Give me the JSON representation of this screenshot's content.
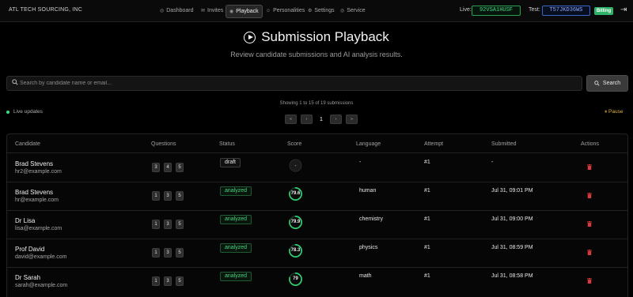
{
  "nav": {
    "brand": "ATL TECH SOURCING, INC",
    "items": [
      {
        "label": "Dashboard",
        "icon": "dashboard-icon",
        "glyph": "◎"
      },
      {
        "label": "Invites",
        "icon": "invites-icon",
        "glyph": "✉"
      },
      {
        "label": "Playback",
        "icon": "playback-icon",
        "glyph": "◉"
      },
      {
        "label": "Personalities",
        "icon": "personalities-icon",
        "glyph": "☺"
      },
      {
        "label": "Settings",
        "icon": "settings-icon",
        "glyph": "⚙"
      },
      {
        "label": "Service",
        "icon": "service-icon",
        "glyph": "◎"
      }
    ],
    "live_label": "Live:",
    "live_key": "92VSA1HUSF",
    "test_label": "Test:",
    "test_key": "T57JKD36WS",
    "billing_label": "Billing",
    "logout_glyph": "⇥"
  },
  "header": {
    "title": "Submission Playback",
    "subtitle": "Review candidate submissions and AI analysis results."
  },
  "search": {
    "placeholder": "Search by candidate name or email...",
    "value": "",
    "button_label": "Search"
  },
  "meta": {
    "showing": "Showing 1 to 15 of 19 submissions",
    "live_updates": "Live updates",
    "pause": "⏸ Pause"
  },
  "pagination": {
    "first": "«",
    "prev": "‹",
    "page": "1",
    "next": "›",
    "last": "»"
  },
  "table": {
    "headers": [
      "Candidate",
      "Questions",
      "Status",
      "Score",
      "Language",
      "Attempt",
      "Submitted",
      "Actions"
    ],
    "rows": [
      {
        "name": "Brad Stevens",
        "email": "hr2@example.com",
        "questions": [
          "3",
          "4",
          "5"
        ],
        "status": "draft",
        "score": null,
        "score_text": "",
        "language": "-",
        "attempt": "#1",
        "submitted": "-"
      },
      {
        "name": "Brad Stevens",
        "email": "hr@example.com",
        "questions": [
          "1",
          "3",
          "5"
        ],
        "status": "analyzed",
        "score": 79.6,
        "score_text": "79.6",
        "language": "human",
        "attempt": "#1",
        "submitted": "Jul 31, 09:01 PM"
      },
      {
        "name": "Dr Lisa",
        "email": "lisa@example.com",
        "questions": [
          "1",
          "3",
          "5"
        ],
        "status": "analyzed",
        "score": 79.9,
        "score_text": "79.9",
        "language": "chemistry",
        "attempt": "#1",
        "submitted": "Jul 31, 09:00 PM"
      },
      {
        "name": "Prof David",
        "email": "david@example.com",
        "questions": [
          "1",
          "3",
          "5"
        ],
        "status": "analyzed",
        "score": 78.3,
        "score_text": "78.3",
        "language": "physics",
        "attempt": "#1",
        "submitted": "Jul 31, 08:59 PM"
      },
      {
        "name": "Dr Sarah",
        "email": "sarah@example.com",
        "questions": [
          "1",
          "3",
          "5"
        ],
        "status": "analyzed",
        "score": 79,
        "score_text": "79",
        "language": "math",
        "attempt": "#1",
        "submitted": "Jul 31, 08:58 PM"
      }
    ]
  },
  "colors": {
    "accent_green": "#3ddc84",
    "score_ring": "#2fcf6f",
    "delete_red": "#d9393c",
    "pause_yellow": "#e0b23a"
  }
}
